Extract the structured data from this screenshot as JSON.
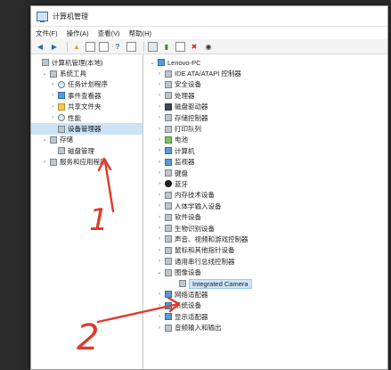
{
  "window": {
    "title": "计算机管理"
  },
  "menu": [
    "文件(F)",
    "操作(A)",
    "查看(V)",
    "帮助(H)"
  ],
  "left_tree": [
    {
      "label": "计算机管理(本地)",
      "arrow": "",
      "indent": 0,
      "icon": "computer-icon",
      "style": "gray"
    },
    {
      "label": "系统工具",
      "arrow": "⌄",
      "indent": 1,
      "icon": "tools-icon",
      "style": "gray"
    },
    {
      "label": "任务计划程序",
      "arrow": "›",
      "indent": 2,
      "icon": "clock-icon",
      "style": "round"
    },
    {
      "label": "事件查看器",
      "arrow": "›",
      "indent": 2,
      "icon": "event-viewer-icon",
      "style": "blue"
    },
    {
      "label": "共享文件夹",
      "arrow": "›",
      "indent": 2,
      "icon": "shared-folder-icon",
      "style": "yellow"
    },
    {
      "label": "性能",
      "arrow": "›",
      "indent": 2,
      "icon": "performance-icon",
      "style": "round"
    },
    {
      "label": "设备管理器",
      "arrow": "",
      "indent": 2,
      "icon": "device-manager-icon",
      "style": "gray",
      "selected": true
    },
    {
      "label": "存储",
      "arrow": "⌄",
      "indent": 1,
      "icon": "storage-icon",
      "style": "gray"
    },
    {
      "label": "磁盘管理",
      "arrow": "",
      "indent": 2,
      "icon": "disk-icon",
      "style": "gray"
    },
    {
      "label": "服务和应用程序",
      "arrow": "›",
      "indent": 1,
      "icon": "services-icon",
      "style": "gray"
    }
  ],
  "right_tree": {
    "root": "Lenovo-PC",
    "items": [
      {
        "label": "IDE ATA/ATAPI 控制器",
        "icon": "ide-icon",
        "style": "gray"
      },
      {
        "label": "安全设备",
        "icon": "security-device-icon",
        "style": "gray"
      },
      {
        "label": "处理器",
        "icon": "processor-icon",
        "style": "gray"
      },
      {
        "label": "磁盘驱动器",
        "icon": "disk-drive-icon",
        "style": "dark"
      },
      {
        "label": "存储控制器",
        "icon": "storage-controller-icon",
        "style": "gray"
      },
      {
        "label": "打印队列",
        "icon": "printer-icon",
        "style": "gray"
      },
      {
        "label": "电池",
        "icon": "battery-icon",
        "style": "green"
      },
      {
        "label": "计算机",
        "icon": "computer-icon",
        "style": "blue"
      },
      {
        "label": "监视器",
        "icon": "monitor-icon",
        "style": "blue"
      },
      {
        "label": "键盘",
        "icon": "keyboard-icon",
        "style": "gray"
      },
      {
        "label": "蓝牙",
        "icon": "bluetooth-icon",
        "style": "black"
      },
      {
        "label": "内存技术设备",
        "icon": "memory-device-icon",
        "style": "gray"
      },
      {
        "label": "人体学输入设备",
        "icon": "hid-icon",
        "style": "gray"
      },
      {
        "label": "软件设备",
        "icon": "software-device-icon",
        "style": "gray"
      },
      {
        "label": "生物识别设备",
        "icon": "biometric-icon",
        "style": "gray"
      },
      {
        "label": "声音、视频和游戏控制器",
        "icon": "sound-icon",
        "style": "gray"
      },
      {
        "label": "鼠标和其他指针设备",
        "icon": "mouse-icon",
        "style": "gray"
      },
      {
        "label": "通用串行总线控制器",
        "icon": "usb-icon",
        "style": "gray"
      },
      {
        "label": "图像设备",
        "icon": "imaging-device-icon",
        "style": "gray",
        "expanded": true
      },
      {
        "label": "Integrated Camera",
        "icon": "camera-icon",
        "style": "gray",
        "child": true
      },
      {
        "label": "网络适配器",
        "icon": "network-adapter-icon",
        "style": "blue"
      },
      {
        "label": "系统设备",
        "icon": "system-device-icon",
        "style": "blue"
      },
      {
        "label": "显示适配器",
        "icon": "display-adapter-icon",
        "style": "blue"
      },
      {
        "label": "音频输入和输出",
        "icon": "audio-io-icon",
        "style": "gray"
      }
    ]
  },
  "annotations": {
    "mark1": "1",
    "mark2": "2"
  },
  "colors": {
    "selection": "#cde4f7",
    "annotation_red": "#e03a2e"
  }
}
